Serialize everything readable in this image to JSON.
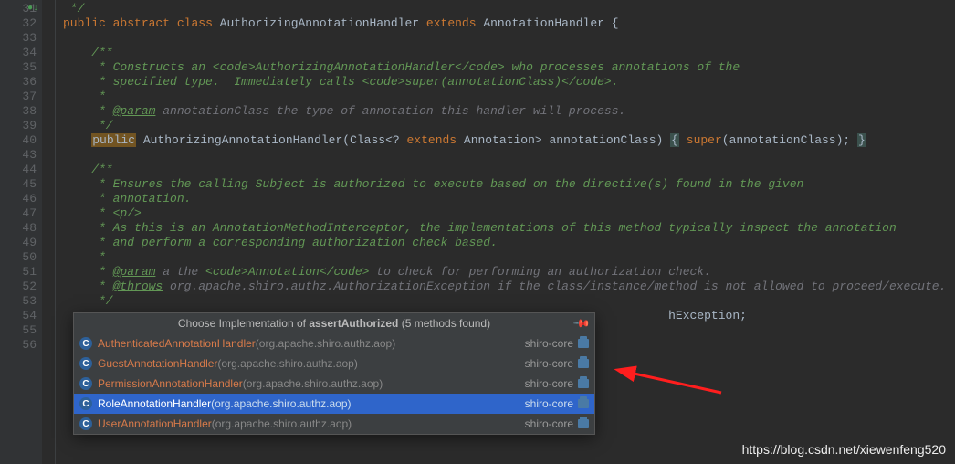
{
  "lineStart": 31,
  "lines": [
    {
      "n": 31,
      "seg": [
        {
          "t": " */",
          "c": "c-com"
        }
      ]
    },
    {
      "n": 32,
      "seg": [
        {
          "t": "public",
          "c": "c-kw"
        },
        {
          "t": " "
        },
        {
          "t": "abstract",
          "c": "c-kw"
        },
        {
          "t": " "
        },
        {
          "t": "class",
          "c": "c-kw"
        },
        {
          "t": " AuthorizingAnnotationHandler ",
          "c": "c-cls"
        },
        {
          "t": "extends",
          "c": "c-kw"
        },
        {
          "t": " AnnotationHandler {",
          "c": "c-cls"
        }
      ]
    },
    {
      "n": 33,
      "seg": [
        {
          "t": ""
        }
      ]
    },
    {
      "n": 34,
      "seg": [
        {
          "t": "    /**",
          "c": "c-com"
        }
      ]
    },
    {
      "n": 35,
      "seg": [
        {
          "t": "     * Constructs an ",
          "c": "c-com"
        },
        {
          "t": "<code>",
          "c": "c-com"
        },
        {
          "t": "AuthorizingAnnotationHandler",
          "c": "c-com"
        },
        {
          "t": "</code>",
          "c": "c-com"
        },
        {
          "t": " who processes annotations of the",
          "c": "c-com"
        }
      ]
    },
    {
      "n": 36,
      "seg": [
        {
          "t": "     * specified type.  Immediately calls ",
          "c": "c-com"
        },
        {
          "t": "<code>",
          "c": "c-com"
        },
        {
          "t": "super(annotationClass)",
          "c": "c-com"
        },
        {
          "t": "</code>",
          "c": "c-com"
        },
        {
          "t": ".",
          "c": "c-com"
        }
      ]
    },
    {
      "n": 37,
      "seg": [
        {
          "t": "     *",
          "c": "c-com"
        }
      ]
    },
    {
      "n": 38,
      "seg": [
        {
          "t": "     * ",
          "c": "c-com"
        },
        {
          "t": "@param",
          "c": "c-tag"
        },
        {
          "t": " annotationClass the type of annotation this handler will process.",
          "c": "c-param"
        }
      ]
    },
    {
      "n": 39,
      "seg": [
        {
          "t": "     */",
          "c": "c-com"
        }
      ]
    },
    {
      "n": 40,
      "seg": [
        {
          "t": "    "
        },
        {
          "t": "public",
          "c": "hl-y"
        },
        {
          "t": " AuthorizingAnnotationHandler(Class<? ",
          "c": "c-cls"
        },
        {
          "t": "extends",
          "c": "c-kw"
        },
        {
          "t": " Annotation> annotationClass) ",
          "c": "c-cls"
        },
        {
          "t": "{",
          "c": "brace-bg"
        },
        {
          "t": " "
        },
        {
          "t": "super",
          "c": "c-kw"
        },
        {
          "t": "(annotationClass); "
        },
        {
          "t": "}",
          "c": "brace-bg"
        }
      ]
    },
    {
      "n": 43,
      "seg": [
        {
          "t": ""
        }
      ]
    },
    {
      "n": 44,
      "seg": [
        {
          "t": "    /**",
          "c": "c-com"
        }
      ]
    },
    {
      "n": 45,
      "seg": [
        {
          "t": "     * Ensures the calling Subject is authorized to execute based on the directive(s) found in the given",
          "c": "c-com"
        }
      ]
    },
    {
      "n": 46,
      "seg": [
        {
          "t": "     * annotation.",
          "c": "c-com"
        }
      ]
    },
    {
      "n": 47,
      "seg": [
        {
          "t": "     * <p/>",
          "c": "c-com"
        }
      ]
    },
    {
      "n": 48,
      "seg": [
        {
          "t": "     * As this is an AnnotationMethodInterceptor, the implementations of this method typically inspect the annotation",
          "c": "c-com"
        }
      ]
    },
    {
      "n": 49,
      "seg": [
        {
          "t": "     * and perform a corresponding authorization check based.",
          "c": "c-com"
        }
      ]
    },
    {
      "n": 50,
      "seg": [
        {
          "t": "     *",
          "c": "c-com"
        }
      ]
    },
    {
      "n": 51,
      "seg": [
        {
          "t": "     * ",
          "c": "c-com"
        },
        {
          "t": "@param",
          "c": "c-tag"
        },
        {
          "t": " a the ",
          "c": "c-param"
        },
        {
          "t": "<code>",
          "c": "c-com"
        },
        {
          "t": "Annotation",
          "c": "c-com"
        },
        {
          "t": "</code>",
          "c": "c-com"
        },
        {
          "t": " to check for performing an authorization check.",
          "c": "c-param"
        }
      ]
    },
    {
      "n": 52,
      "seg": [
        {
          "t": "     * ",
          "c": "c-com"
        },
        {
          "t": "@throws",
          "c": "c-tag"
        },
        {
          "t": " org.apache.shiro.authz.AuthorizationException",
          "c": "c-param"
        },
        {
          "t": " if the class/instance/method is not allowed to proceed/execute.",
          "c": "c-param"
        }
      ]
    },
    {
      "n": 53,
      "seg": [
        {
          "t": "     */",
          "c": "c-com"
        }
      ]
    },
    {
      "n": 54,
      "seg": [
        {
          "t": "                                                                                     hException;",
          "c": "c-cls"
        }
      ]
    },
    {
      "n": 55,
      "seg": [
        {
          "t": ""
        }
      ]
    },
    {
      "n": 56,
      "seg": [
        {
          "t": ""
        }
      ]
    }
  ],
  "popup": {
    "titlePrefix": "Choose Implementation of ",
    "titleBold": "assertAuthorized",
    "titleSuffix": " (5 methods found)",
    "items": [
      {
        "name": "AuthenticatedAnnotationHandler",
        "pkg": " (org.apache.shiro.authz.aop)",
        "mod": "shiro-core",
        "sel": false
      },
      {
        "name": "GuestAnnotationHandler",
        "pkg": " (org.apache.shiro.authz.aop)",
        "mod": "shiro-core",
        "sel": false
      },
      {
        "name": "PermissionAnnotationHandler",
        "pkg": " (org.apache.shiro.authz.aop)",
        "mod": "shiro-core",
        "sel": false
      },
      {
        "name": "RoleAnnotationHandler",
        "pkg": " (org.apache.shiro.authz.aop)",
        "mod": "shiro-core",
        "sel": true
      },
      {
        "name": "UserAnnotationHandler",
        "pkg": " (org.apache.shiro.authz.aop)",
        "mod": "shiro-core",
        "sel": false
      }
    ]
  },
  "watermark": "https://blog.csdn.net/xiewenfeng520"
}
